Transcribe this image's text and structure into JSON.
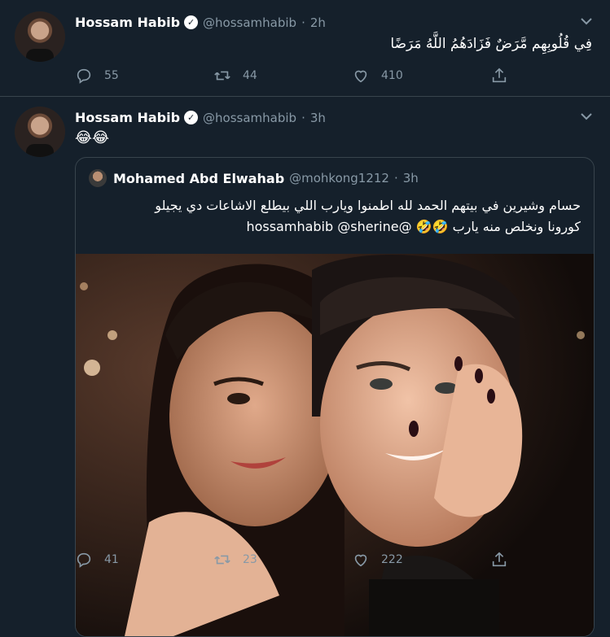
{
  "tweets": [
    {
      "author_name": "Hossam Habib",
      "handle": "@hossamhabib",
      "separator": "·",
      "time": "2h",
      "text": "فِي قُلُوبِهِم مَّرَضٌ فَزَادَهُمُ اللَّهُ مَرَضًا",
      "replies": "55",
      "retweets": "44",
      "likes": "410"
    },
    {
      "author_name": "Hossam Habib",
      "handle": "@hossamhabib",
      "separator": "·",
      "time": "3h",
      "text": "😂😂",
      "replies": "41",
      "retweets": "23",
      "likes": "222",
      "quoted": {
        "author_name": "Mohamed Abd Elwahab",
        "handle": "@mohkong1212",
        "separator": "·",
        "time": "3h",
        "line1": "حسام وشيرين في بيتهم الحمد لله اطمنوا ويارب اللي بيطلع الاشاعات دي يجيلو",
        "line2": "كورونا ونخلص منه يارب 🤣🤣 @hossamhabib @sherine"
      }
    }
  ],
  "icons": {
    "reply": "reply-icon",
    "retweet": "retweet-icon",
    "like": "heart-icon",
    "share": "share-icon",
    "caret": "chevron-down-icon",
    "verified": "verified-badge-icon"
  },
  "colors": {
    "background": "#15202b",
    "border": "#38444d",
    "muted": "#8899a6",
    "text": "#ffffff"
  }
}
